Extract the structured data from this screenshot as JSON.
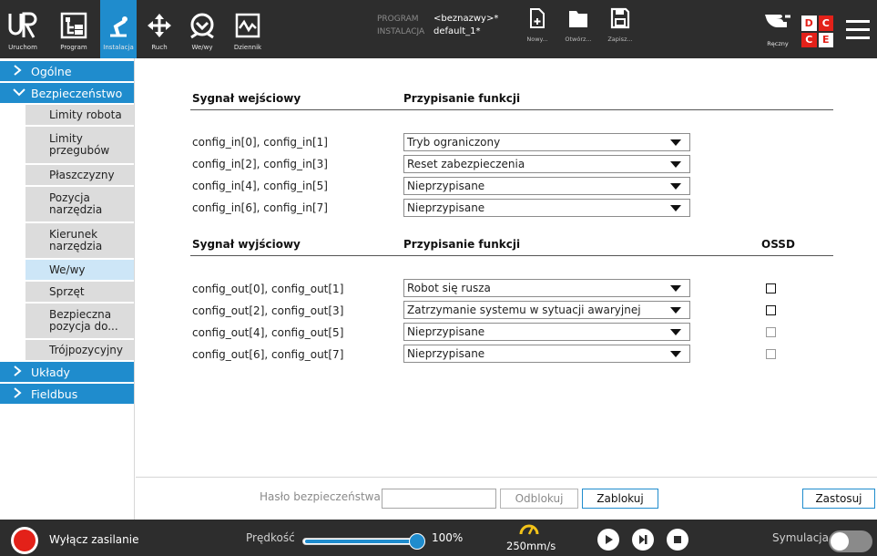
{
  "header": {
    "nav": [
      {
        "label": "Uruchom",
        "icon": "ur-logo-icon"
      },
      {
        "label": "Program",
        "icon": "program-icon"
      },
      {
        "label": "Instalacja",
        "icon": "installation-icon",
        "active": true
      },
      {
        "label": "Ruch",
        "icon": "move-icon"
      },
      {
        "label": "We/wy",
        "icon": "io-icon"
      },
      {
        "label": "Dziennik",
        "icon": "log-icon"
      }
    ],
    "program_key": "PROGRAM",
    "program_value": "<beznazwy>*",
    "installation_key": "INSTALACJA",
    "installation_value": "default_1*",
    "file_buttons": [
      {
        "label": "Nowy...",
        "icon": "new-file-icon"
      },
      {
        "label": "Otwórz...",
        "icon": "folder-icon"
      },
      {
        "label": "Zapisz...",
        "icon": "save-icon"
      }
    ],
    "mode_label": "Ręczny",
    "dcce": [
      "D",
      "C",
      "C",
      "E"
    ],
    "colors": {
      "bg": "#2d2d2d",
      "accent": "#1f8ccd",
      "dcce_red": "#e32119"
    }
  },
  "sidebar": {
    "categories": [
      {
        "label": "Ogólne",
        "expanded": false
      },
      {
        "label": "Bezpieczeństwo",
        "expanded": true
      },
      {
        "label": "Układy",
        "expanded": false
      },
      {
        "label": "Fieldbus",
        "expanded": false
      }
    ],
    "safety_items": [
      {
        "label": "Limity robota"
      },
      {
        "label": "Limity przegubów"
      },
      {
        "label": "Płaszczyzny"
      },
      {
        "label": "Pozycja narzędzia"
      },
      {
        "label": "Kierunek narzędzia"
      },
      {
        "label": "We/wy",
        "selected": true
      },
      {
        "label": "Sprzęt"
      },
      {
        "label": "Bezpieczna pozycja do..."
      },
      {
        "label": "Trójpozycyjny"
      }
    ]
  },
  "main": {
    "input_header": {
      "signal": "Sygnał wejściowy",
      "function": "Przypisanie funkcji"
    },
    "inputs": [
      {
        "signal": "config_in[0], config_in[1]",
        "function": "Tryb ograniczony"
      },
      {
        "signal": "config_in[2], config_in[3]",
        "function": "Reset zabezpieczenia"
      },
      {
        "signal": "config_in[4], config_in[5]",
        "function": "Nieprzypisane"
      },
      {
        "signal": "config_in[6], config_in[7]",
        "function": "Nieprzypisane"
      }
    ],
    "output_header": {
      "signal": "Sygnał wyjściowy",
      "function": "Przypisanie funkcji",
      "ossd": "OSSD"
    },
    "outputs": [
      {
        "signal": "config_out[0], config_out[1]",
        "function": "Robot się rusza",
        "ossd_enabled": true
      },
      {
        "signal": "config_out[2], config_out[3]",
        "function": "Zatrzymanie systemu w sytuacji awaryjnej",
        "ossd_enabled": true
      },
      {
        "signal": "config_out[4], config_out[5]",
        "function": "Nieprzypisane",
        "ossd_enabled": false
      },
      {
        "signal": "config_out[6], config_out[7]",
        "function": "Nieprzypisane",
        "ossd_enabled": false
      }
    ],
    "password_label": "Hasło bezpieczeństwa",
    "password_value": "",
    "unlock_label": "Odblokuj",
    "lock_label": "Zablokuj",
    "apply_label": "Zastosuj"
  },
  "footer": {
    "power_label": "Wyłącz zasilanie",
    "speed_label": "Prędkość",
    "speed_value": "100%",
    "speed_fraction": 1.0,
    "tcp_speed": "250mm/s",
    "simulation_label": "Symulacja",
    "simulation_on": false
  }
}
